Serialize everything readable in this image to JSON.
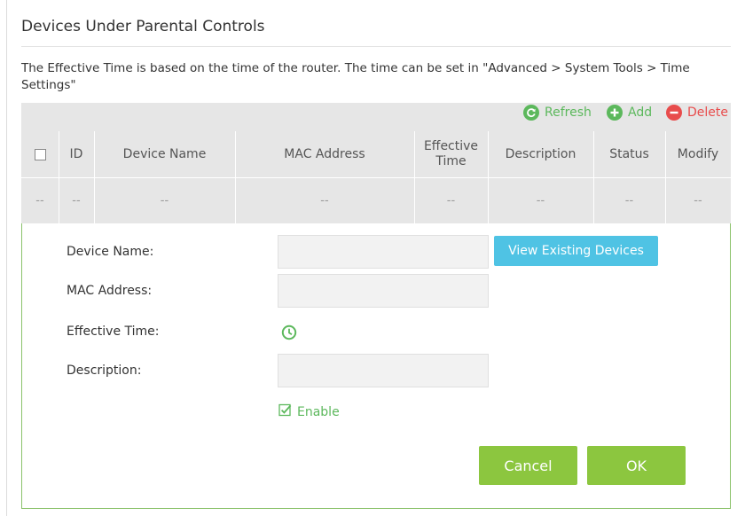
{
  "page": {
    "title": "Devices Under Parental Controls",
    "note": "The Effective Time is based on the time of the router. The time can be set in \"Advanced > System Tools > Time Settings\""
  },
  "toolbar": {
    "refresh_label": "Refresh",
    "add_label": "Add",
    "delete_label": "Delete",
    "refresh_icon": "refresh-icon",
    "add_icon": "plus-circle-icon",
    "delete_icon": "minus-circle-icon"
  },
  "table": {
    "columns": [
      {
        "key": "select",
        "label": ""
      },
      {
        "key": "id",
        "label": "ID"
      },
      {
        "key": "device_name",
        "label": "Device Name"
      },
      {
        "key": "mac",
        "label": "MAC Address"
      },
      {
        "key": "effective_time",
        "label": "Effective Time"
      },
      {
        "key": "description",
        "label": "Description"
      },
      {
        "key": "status",
        "label": "Status"
      },
      {
        "key": "modify",
        "label": "Modify"
      }
    ],
    "rows": [
      [
        "--",
        "--",
        "--",
        "--",
        "--",
        "--",
        "--",
        "--"
      ]
    ]
  },
  "form": {
    "device_name_label": "Device Name:",
    "device_name_value": "",
    "mac_label": "MAC Address:",
    "mac_value": "",
    "effective_time_label": "Effective Time:",
    "effective_time_icon": "clock-icon",
    "description_label": "Description:",
    "description_value": "",
    "view_devices_label": "View Existing Devices",
    "enable_label": "Enable",
    "enable_checked": true,
    "cancel_label": "Cancel",
    "ok_label": "OK"
  },
  "colors": {
    "accent_green": "#8cc63f",
    "refresh_green": "#5cb85c",
    "delete_red": "#e84c4c",
    "view_button_blue": "#4fc3e4",
    "table_bg": "#e6e6e6"
  }
}
